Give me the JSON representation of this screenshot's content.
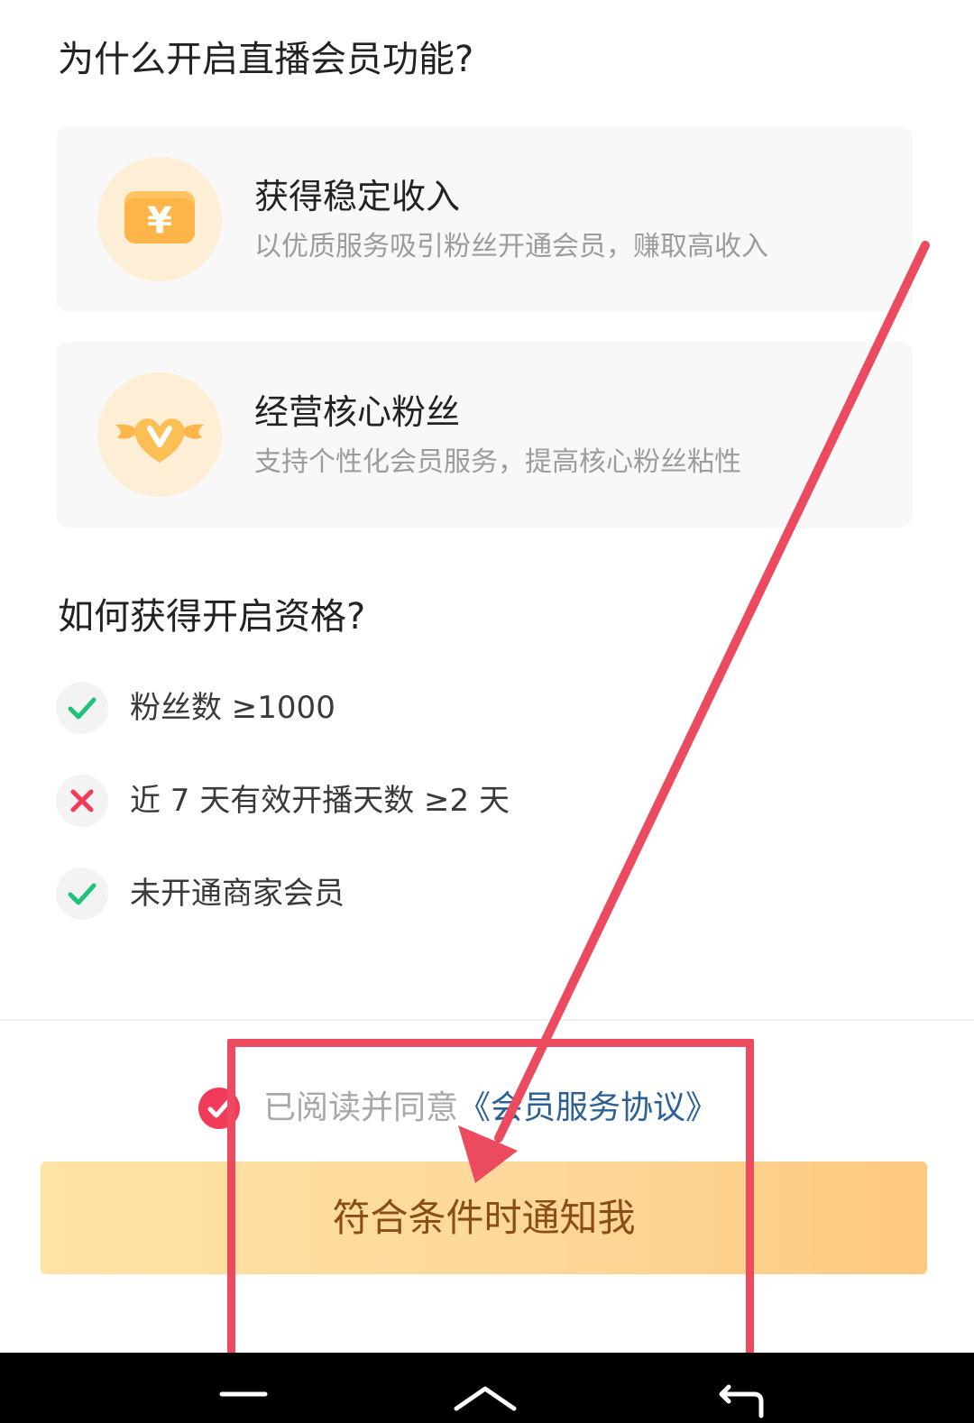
{
  "why_section": {
    "title": "为什么开启直播会员功能?",
    "cards": [
      {
        "icon": "yuan-wallet-icon",
        "title": "获得稳定收入",
        "desc": "以优质服务吸引粉丝开通会员，赚取高收入"
      },
      {
        "icon": "winged-heart-v-icon",
        "title": "经营核心粉丝",
        "desc": "支持个性化会员服务，提高核心粉丝粘性"
      }
    ]
  },
  "how_section": {
    "title": "如何获得开启资格?",
    "requirements": [
      {
        "status": "met",
        "icon": "check-icon",
        "text": "粉丝数 ≥1000"
      },
      {
        "status": "unmet",
        "icon": "cross-icon",
        "text": "近 7 天有效开播天数 ≥2 天"
      },
      {
        "status": "met",
        "icon": "check-icon",
        "text": "未开通商家会员"
      }
    ]
  },
  "agreement": {
    "checked": true,
    "prefix": "已阅读并同意",
    "link": "《会员服务协议》"
  },
  "primary_button": {
    "label": "符合条件时通知我"
  },
  "system_nav": {
    "buttons": [
      "menu-icon",
      "home-icon",
      "back-icon"
    ]
  },
  "colors": {
    "accent_red": "#f23b5a",
    "check_green": "#1ec27a",
    "button_gradient_start": "#fee3a6",
    "button_gradient_end": "#fdc97f",
    "button_text": "#8a4d16",
    "link_blue": "#2c5f93",
    "annotation_red": "#ec4a5f"
  }
}
